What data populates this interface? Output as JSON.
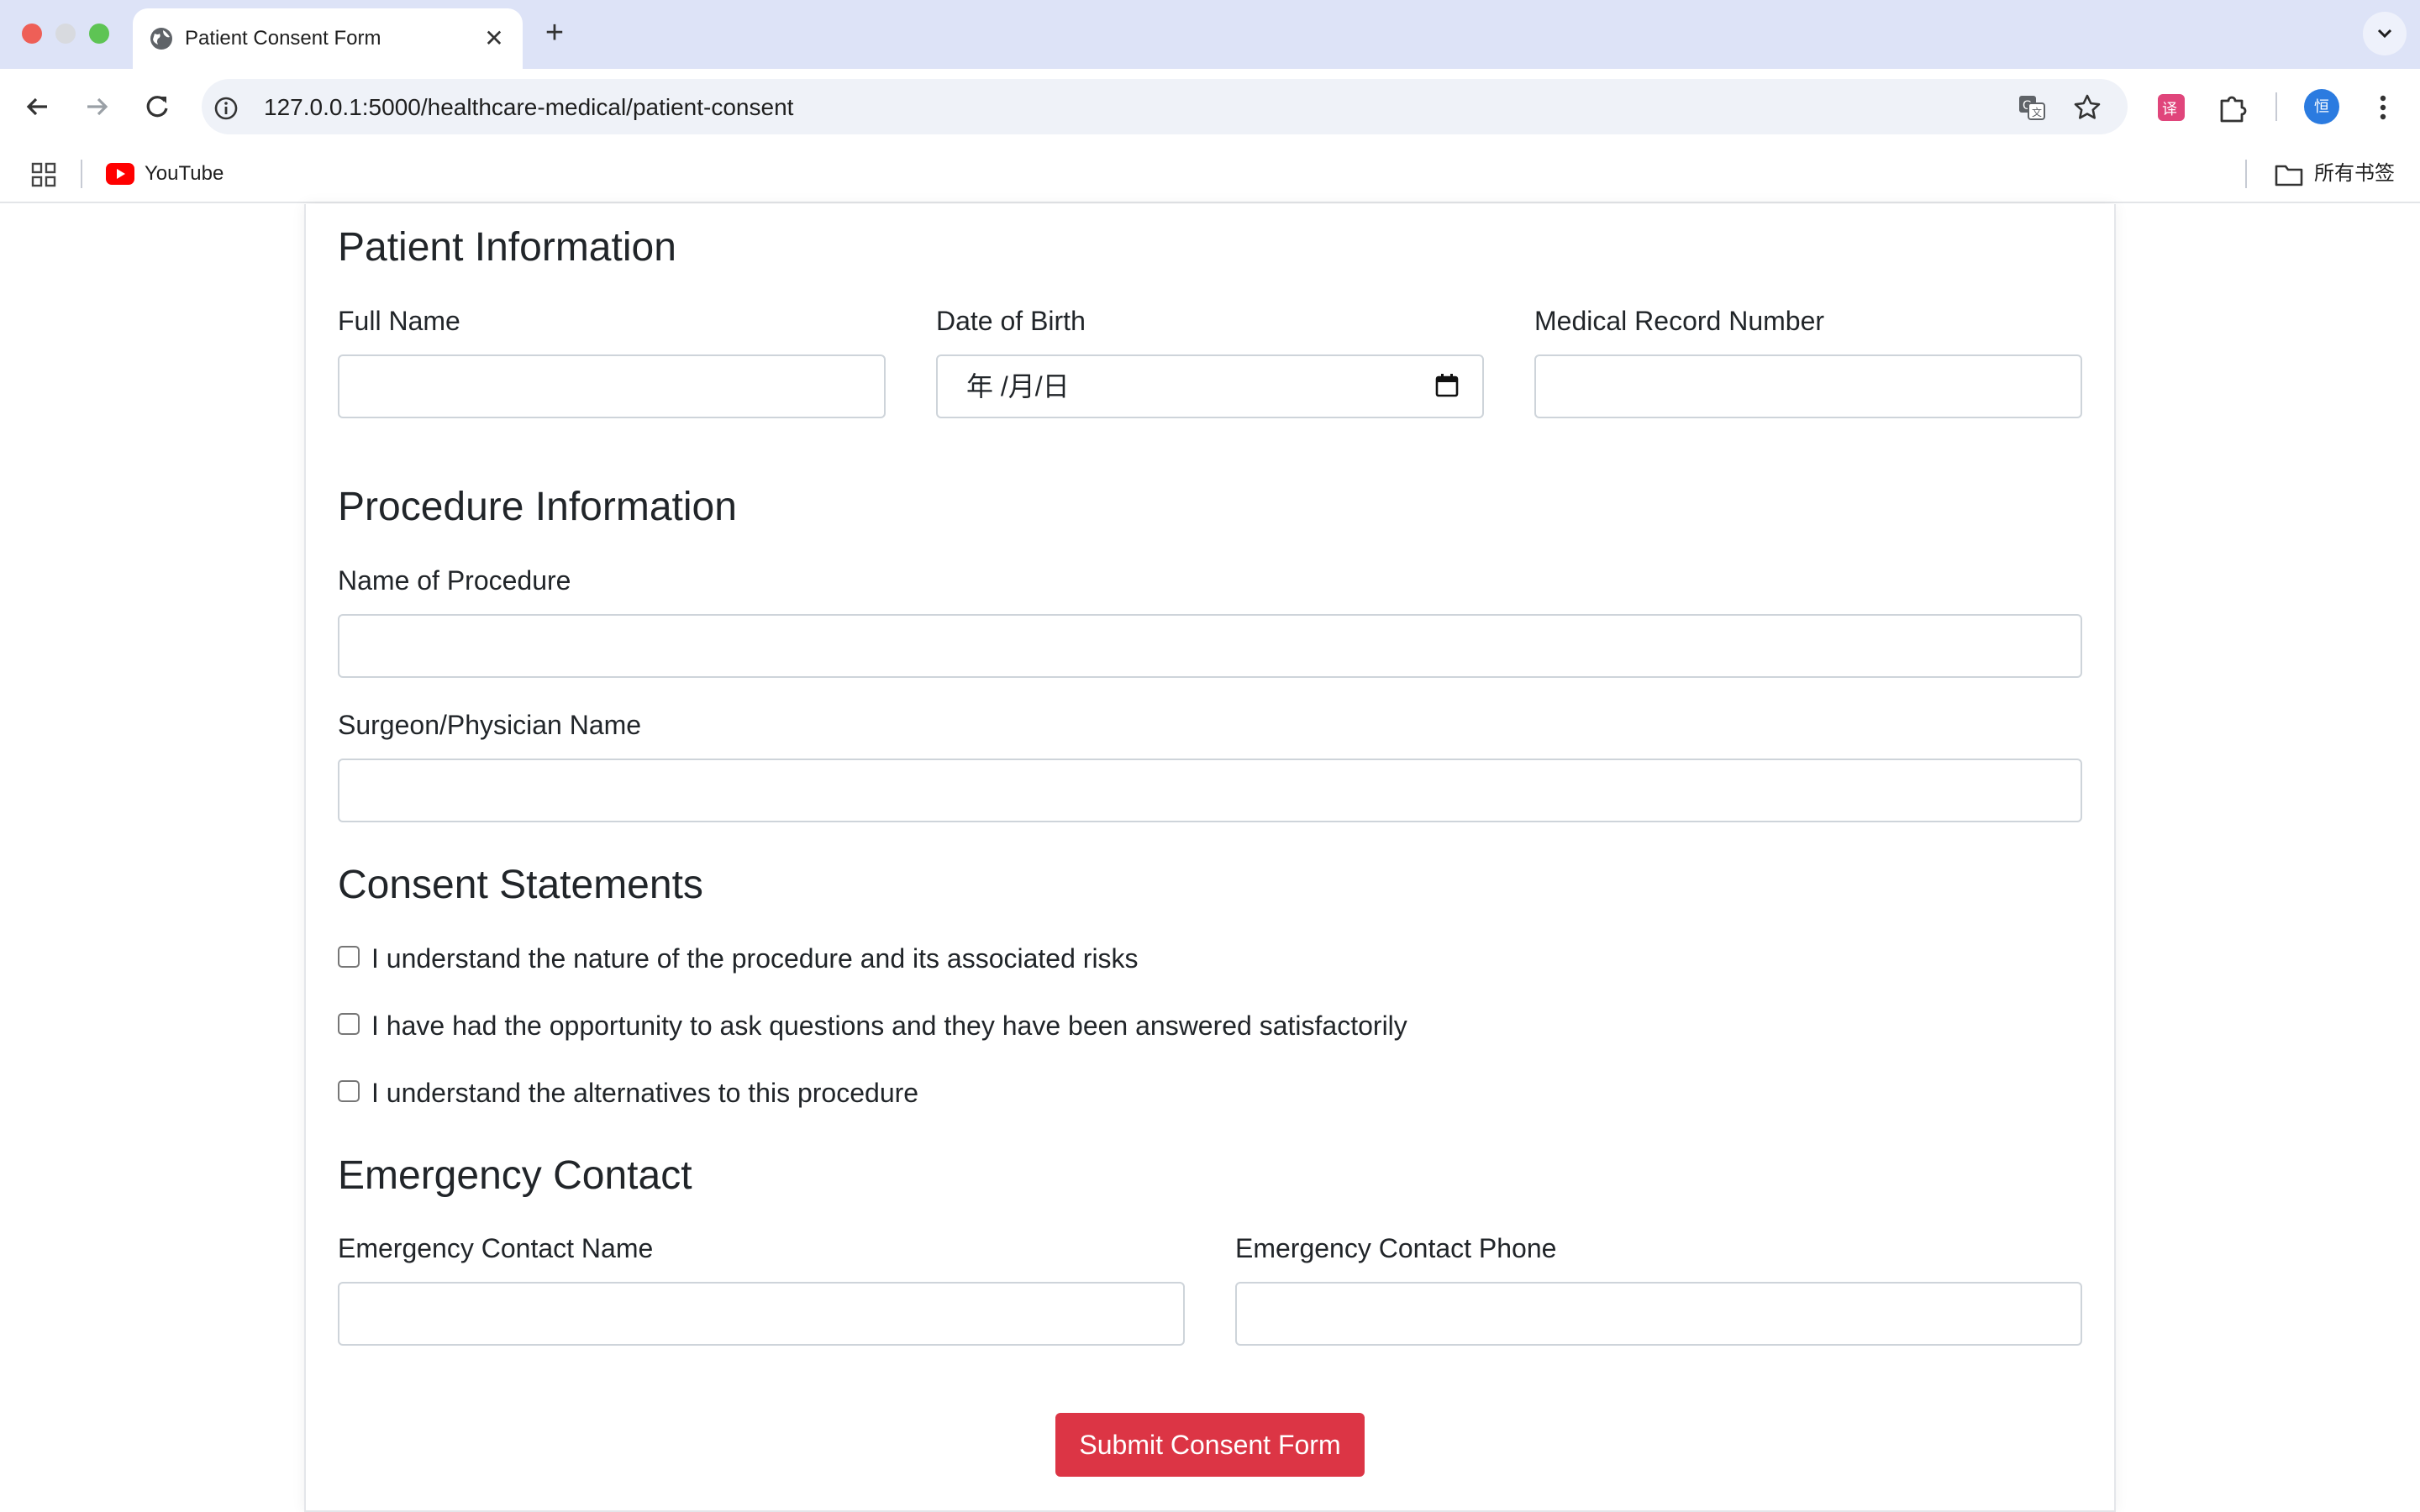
{
  "browser": {
    "tab_title": "Patient Consent Form",
    "tab_close": "✕",
    "new_tab": "+",
    "url": "127.0.0.1:5000/healthcare-medical/patient-consent",
    "avatar_text": "恒",
    "bookmarks": [
      {
        "label": "YouTube",
        "icon": "youtube-icon"
      }
    ],
    "all_bookmarks_label": "所有书签"
  },
  "form": {
    "patient_section": {
      "title": "Patient Information",
      "full_name_label": "Full Name",
      "full_name_value": "",
      "dob_label": "Date of Birth",
      "dob_display": "年 /月/日",
      "mrn_label": "Medical Record Number",
      "mrn_value": ""
    },
    "procedure_section": {
      "title": "Procedure Information",
      "procedure_label": "Name of Procedure",
      "procedure_value": "",
      "surgeon_label": "Surgeon/Physician Name",
      "surgeon_value": ""
    },
    "consent_section": {
      "title": "Consent Statements",
      "statements": [
        {
          "label": "I understand the nature of the procedure and its associated risks",
          "checked": false
        },
        {
          "label": "I have had the opportunity to ask questions and they have been answered satisfactorily",
          "checked": false
        },
        {
          "label": "I understand the alternatives to this procedure",
          "checked": false
        }
      ]
    },
    "emergency_section": {
      "title": "Emergency Contact",
      "name_label": "Emergency Contact Name",
      "name_value": "",
      "phone_label": "Emergency Contact Phone",
      "phone_value": ""
    },
    "submit_label": "Submit Consent Form"
  },
  "colors": {
    "submit_button": "#dc3545",
    "tabstrip": "#dde3f7"
  }
}
